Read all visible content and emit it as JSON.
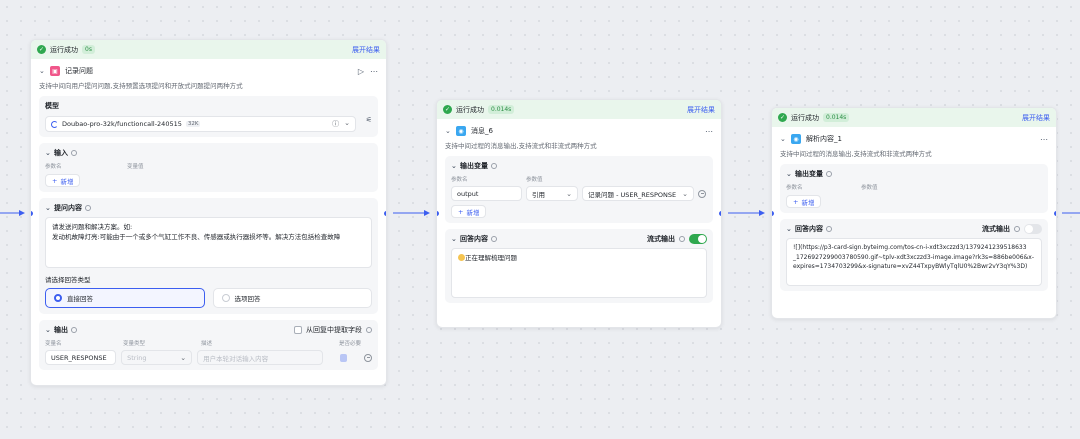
{
  "colors": {
    "accent": "#3c5ef0",
    "success": "#2fa84f",
    "edge": "#3c5ef0"
  },
  "node1": {
    "status": "运行成功",
    "time": "0s",
    "expand": "展开结果",
    "icon": "record-icon",
    "title": "记录问题",
    "desc": "支持中间向用户提问问题,支持预置选项提问和开放式问题提问两种方式",
    "model": {
      "label": "模型",
      "name": "Doubao-pro-32k/functioncall-240515",
      "ctx": "32K"
    },
    "input": {
      "title": "输入",
      "col_name": "参数名",
      "col_value": "变量值",
      "add": "新增"
    },
    "question": {
      "title": "提问内容",
      "line1": "请发送问题和解决方案。如:",
      "line2": "发动机故障灯亮:可能由于一个或多个气缸工作不良、传感器或执行器损坏等。解决方法包括检查故障"
    },
    "answer_type": {
      "label": "请选择回答类型",
      "direct": "直接回答",
      "options": "选项回答"
    },
    "output": {
      "title": "输出",
      "extract": "从回复中提取字段",
      "col_name": "变量名",
      "col_type": "变量类型",
      "col_desc": "描述",
      "col_required": "是否必要",
      "var_name": "USER_RESPONSE",
      "var_type": "String",
      "desc_placeholder": "用户本轮对话输入内容"
    }
  },
  "node2": {
    "status": "运行成功",
    "time": "0.014s",
    "expand": "展开结果",
    "icon": "message-icon",
    "title": "消息_6",
    "desc": "支持中间过程的消息输出,支持流式和非流式两种方式",
    "output_vars": {
      "title": "输出变量",
      "col_name": "参数名",
      "col_value": "参数值",
      "name": "output",
      "ref": "引用",
      "value": "记录问题 - USER_RESPONSE",
      "add": "新增"
    },
    "answer": {
      "title": "回答内容",
      "stream": "流式输出",
      "content": "正在理解梳理问题"
    }
  },
  "node3": {
    "status": "运行成功",
    "time": "0.014s",
    "expand": "展开结果",
    "icon": "parse-icon",
    "title": "解析内容_1",
    "desc": "支持中间过程的消息输出,支持流式和非流式两种方式",
    "output_vars": {
      "title": "输出变量",
      "col_name": "参数名",
      "col_value": "参数值",
      "add": "新增"
    },
    "answer": {
      "title": "回答内容",
      "stream": "流式输出",
      "line1": "![](https://p3-card-sign.byteimg.com/tos-cn-i-xdt3xczzd3/1379241239518633",
      "line2": "_1726927299003780590.gif~tplv-xdt3xczzd3-image.image?rk3s=886be006&x-",
      "line3": "expires=1734703299&x-signature=xvZ44TxpyBWlyTqlU0%2Bwr2vY3qY%3D)"
    }
  }
}
